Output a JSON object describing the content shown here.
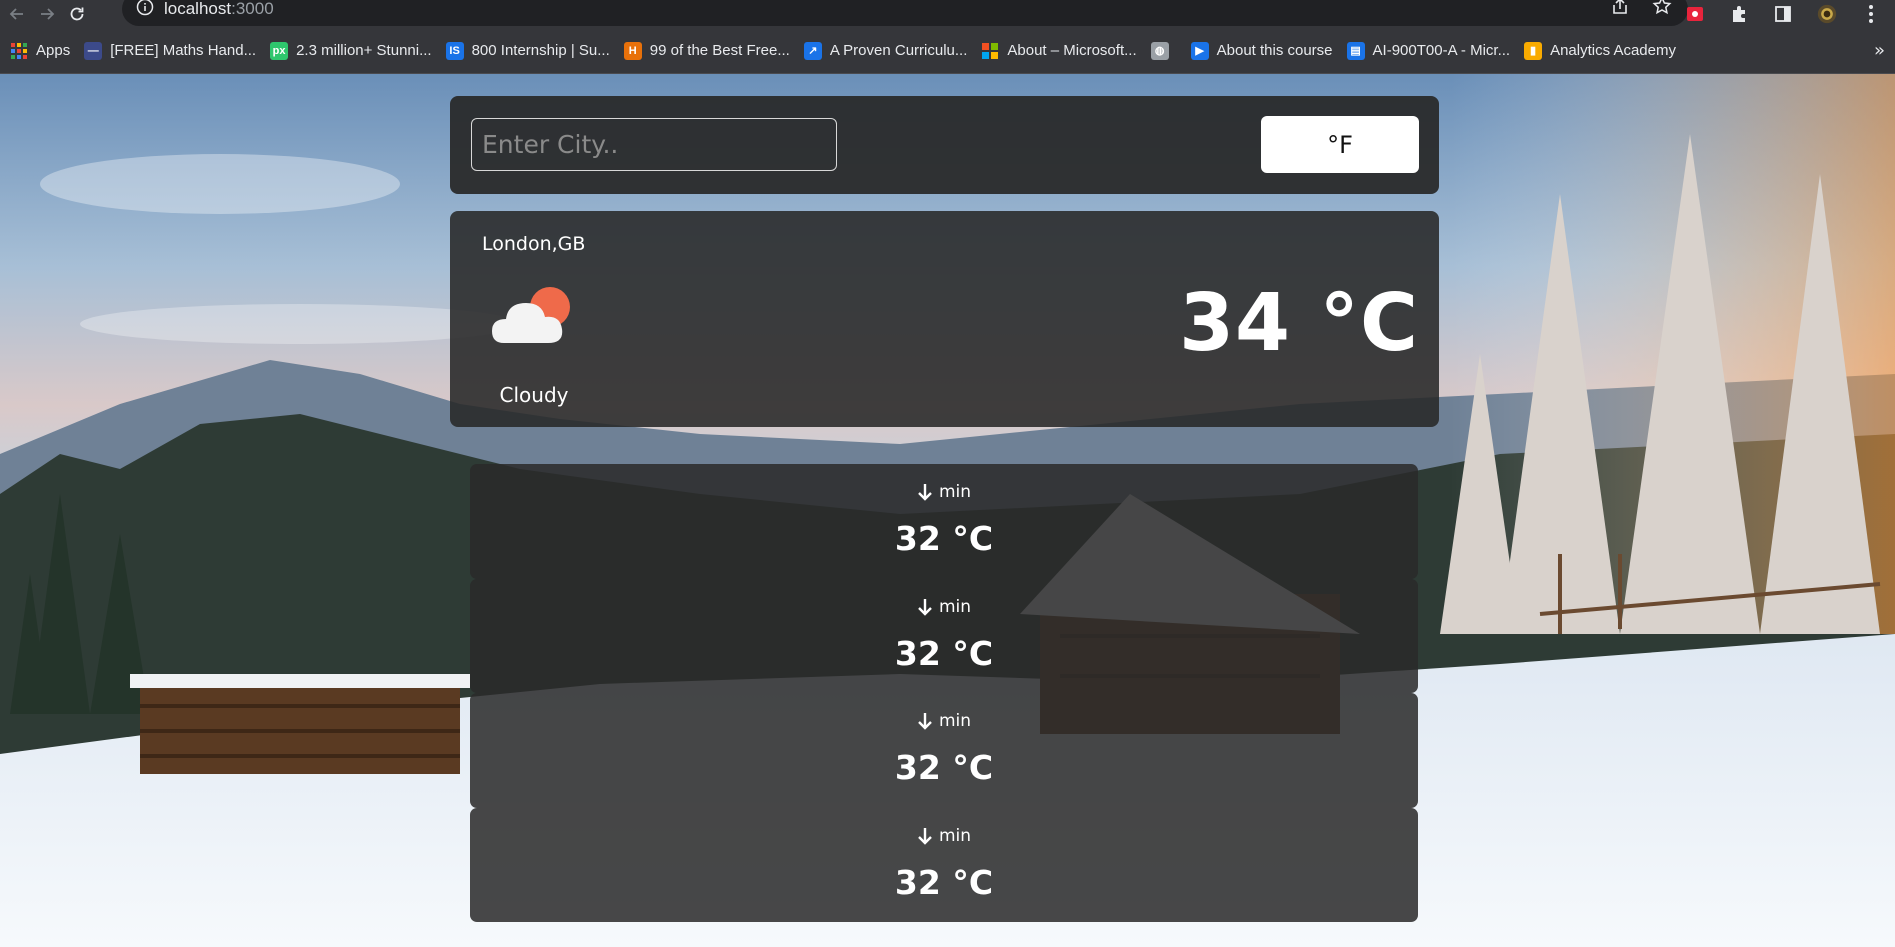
{
  "browser": {
    "url_host": "localhost",
    "url_port": ":3000",
    "bookmarks": [
      {
        "label": "Apps",
        "icon": "apps-grid-icon",
        "color": "#ea4335"
      },
      {
        "label": "[FREE] Maths Hand...",
        "icon": "maths-icon",
        "color": "#3c4a8a"
      },
      {
        "label": "2.3 million+ Stunni...",
        "icon": "pixabay-icon",
        "color": "#2ec66d"
      },
      {
        "label": "800 Internship | Su...",
        "icon": "internship-icon",
        "color": "#1a73e8"
      },
      {
        "label": "99 of the Best Free...",
        "icon": "h-icon",
        "color": "#e8710a"
      },
      {
        "label": "A Proven Curriculu...",
        "icon": "chart-icon",
        "color": "#1a73e8"
      },
      {
        "label": "About – Microsoft...",
        "icon": "microsoft-icon",
        "color": "#f25022"
      },
      {
        "label": "",
        "icon": "globe-icon",
        "color": "#9aa0a6"
      },
      {
        "label": "About this course",
        "icon": "course-icon",
        "color": "#1a73e8"
      },
      {
        "label": "AI-900T00-A - Micr...",
        "icon": "document-icon",
        "color": "#1a73e8"
      },
      {
        "label": "Analytics Academy",
        "icon": "analytics-icon",
        "color": "#f9ab00"
      }
    ]
  },
  "search": {
    "placeholder": "Enter City..",
    "value": "",
    "unit_toggle_label": "°F"
  },
  "current": {
    "location": "London,GB",
    "icon": "cloudy-sun-icon",
    "condition": "Cloudy",
    "temperature": "34 °C"
  },
  "forecast": [
    {
      "label": "min",
      "icon": "arrow-down-icon",
      "temperature": "32 °C"
    },
    {
      "label": "min",
      "icon": "arrow-down-icon",
      "temperature": "32 °C"
    },
    {
      "label": "min",
      "icon": "arrow-down-icon",
      "temperature": "32 °C"
    },
    {
      "label": "min",
      "icon": "arrow-down-icon",
      "temperature": "32 °C"
    }
  ]
}
